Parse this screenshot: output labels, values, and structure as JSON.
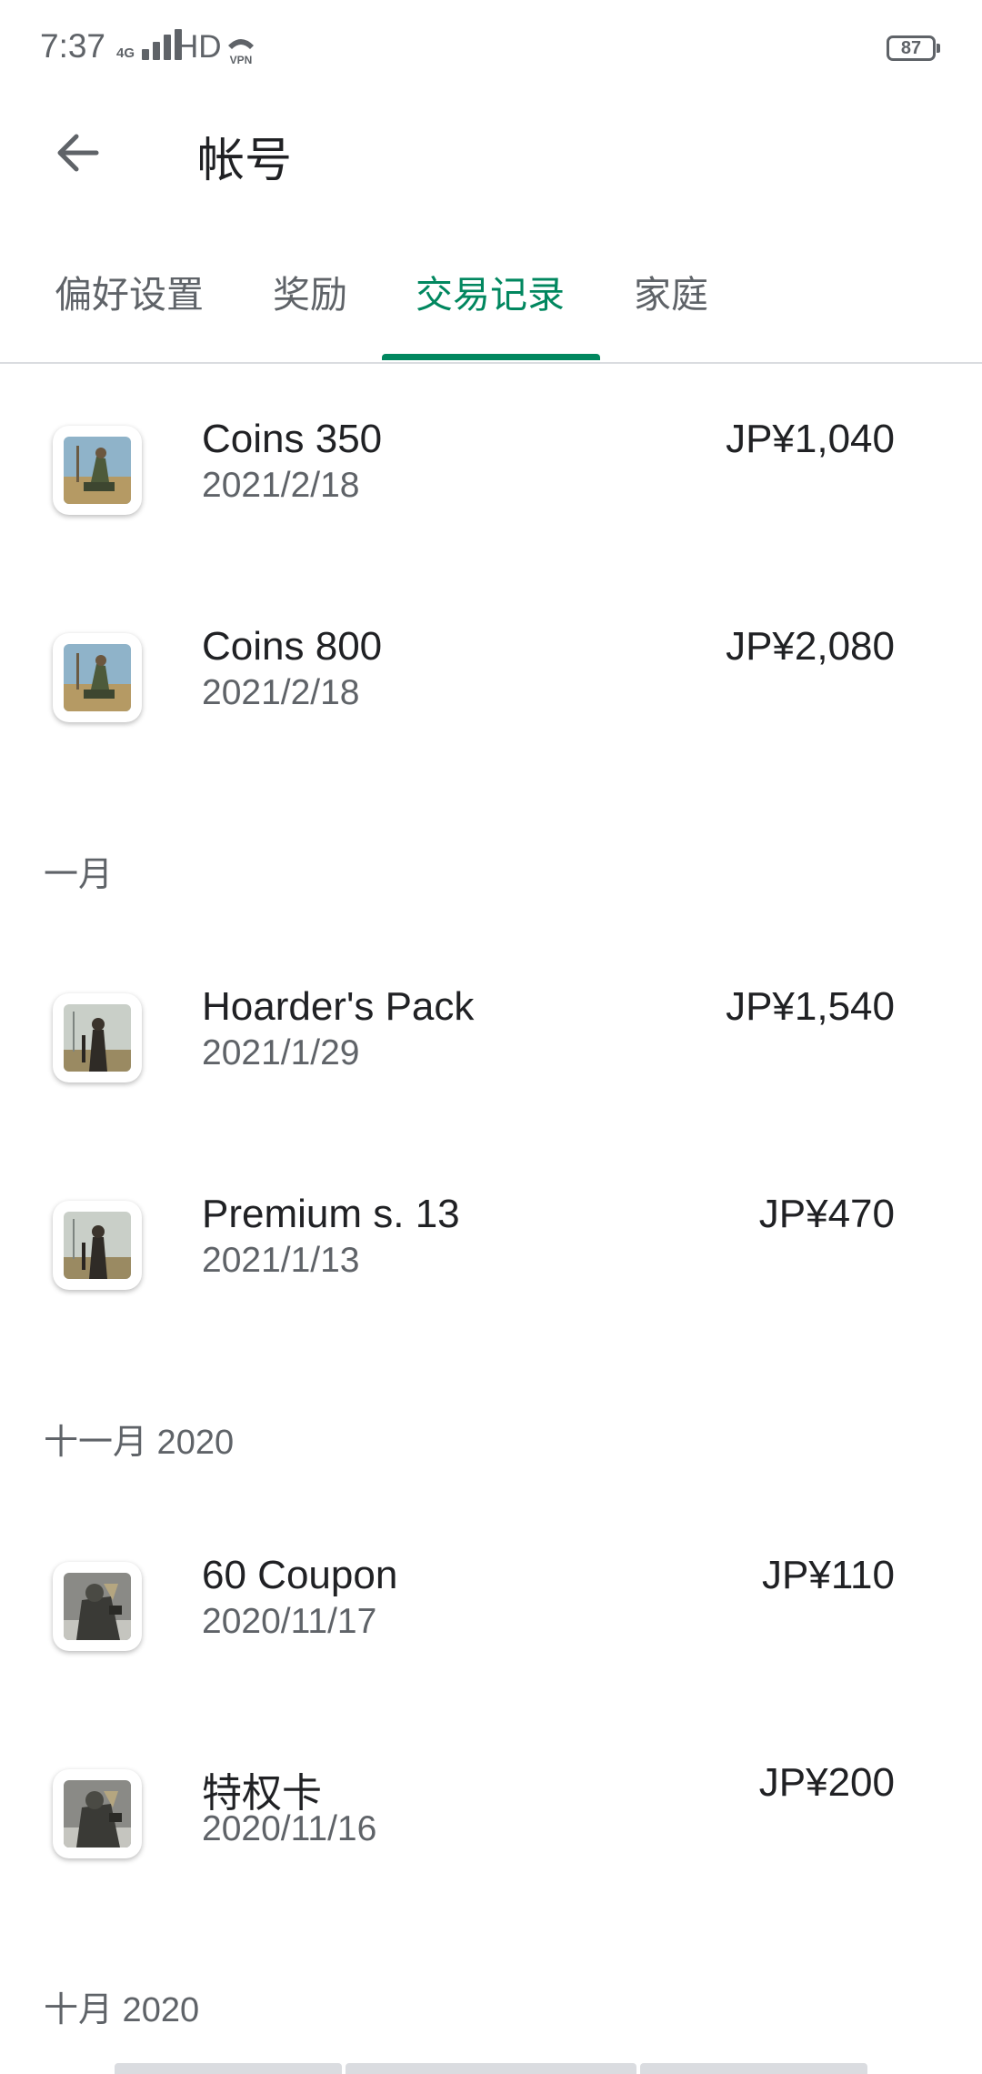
{
  "status_bar": {
    "time": "7:37",
    "network": "4G",
    "hd": "HD",
    "vpn": "VPN",
    "battery": "87"
  },
  "header": {
    "title": "帐号",
    "back_icon": "arrow-back-icon"
  },
  "tabs": [
    {
      "label": "偏好设置",
      "active": false
    },
    {
      "label": "奖励",
      "active": false
    },
    {
      "label": "交易记录",
      "active": true
    },
    {
      "label": "家庭",
      "active": false
    }
  ],
  "accent_color": "#01875f",
  "sections": [
    {
      "header": "",
      "items": [
        {
          "title": "Coins 350",
          "date": "2021/2/18",
          "price": "JP¥1,040",
          "icon": "game-icon-soldier"
        },
        {
          "title": "Coins 800",
          "date": "2021/2/18",
          "price": "JP¥2,080",
          "icon": "game-icon-soldier"
        }
      ]
    },
    {
      "header": "一月",
      "items": [
        {
          "title": "Hoarder's Pack",
          "date": "2021/1/29",
          "price": "JP¥1,540",
          "icon": "game-icon-survivor"
        },
        {
          "title": "Premium s. 13",
          "date": "2021/1/13",
          "price": "JP¥470",
          "icon": "game-icon-survivor"
        }
      ]
    },
    {
      "header": "十一月 2020",
      "items": [
        {
          "title": "60 Coupon",
          "date": "2020/11/17",
          "price": "JP¥110",
          "icon": "game-icon-zombie"
        },
        {
          "title": "特权卡",
          "date": "2020/11/16",
          "price": "JP¥200",
          "icon": "game-icon-zombie"
        }
      ]
    },
    {
      "header": "十月 2020",
      "items": []
    }
  ]
}
